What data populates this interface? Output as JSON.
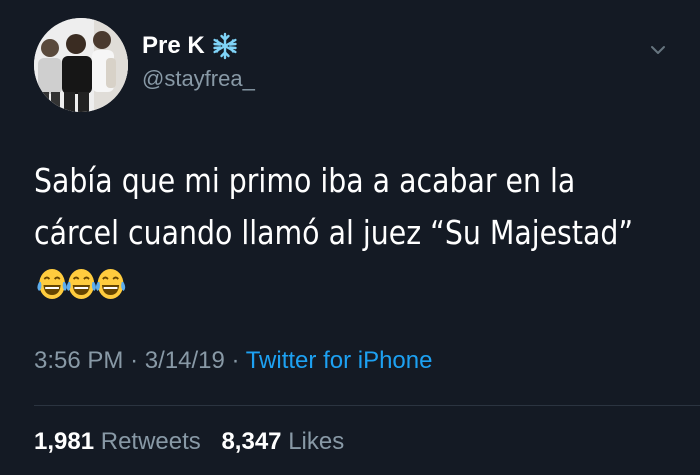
{
  "user": {
    "display_name": "Pre K",
    "handle": "@stayfrea_",
    "verified_badge_icon": "snowflake-icon",
    "avatar_icon": "profile-photo"
  },
  "menu_icon": "chevron-down-icon",
  "tweet": {
    "text": "Sabía que mi primo iba a acabar en la cárcel cuando llamó al juez “Su Majestad”",
    "emojis": [
      "😂",
      "😂",
      "😂"
    ],
    "emoji_icon": "face-with-tears-of-joy-icon"
  },
  "meta": {
    "time": "3:56 PM",
    "separator": "·",
    "date": "3/14/19",
    "source": "Twitter for iPhone"
  },
  "stats": {
    "retweets_count": "1,981",
    "retweets_label": "Retweets",
    "likes_count": "8,347",
    "likes_label": "Likes"
  },
  "colors": {
    "background": "#141a24",
    "primary_text": "#ffffff",
    "secondary_text": "#8899a6",
    "link": "#1da1f2",
    "snowflake": "#7fd3f7"
  }
}
